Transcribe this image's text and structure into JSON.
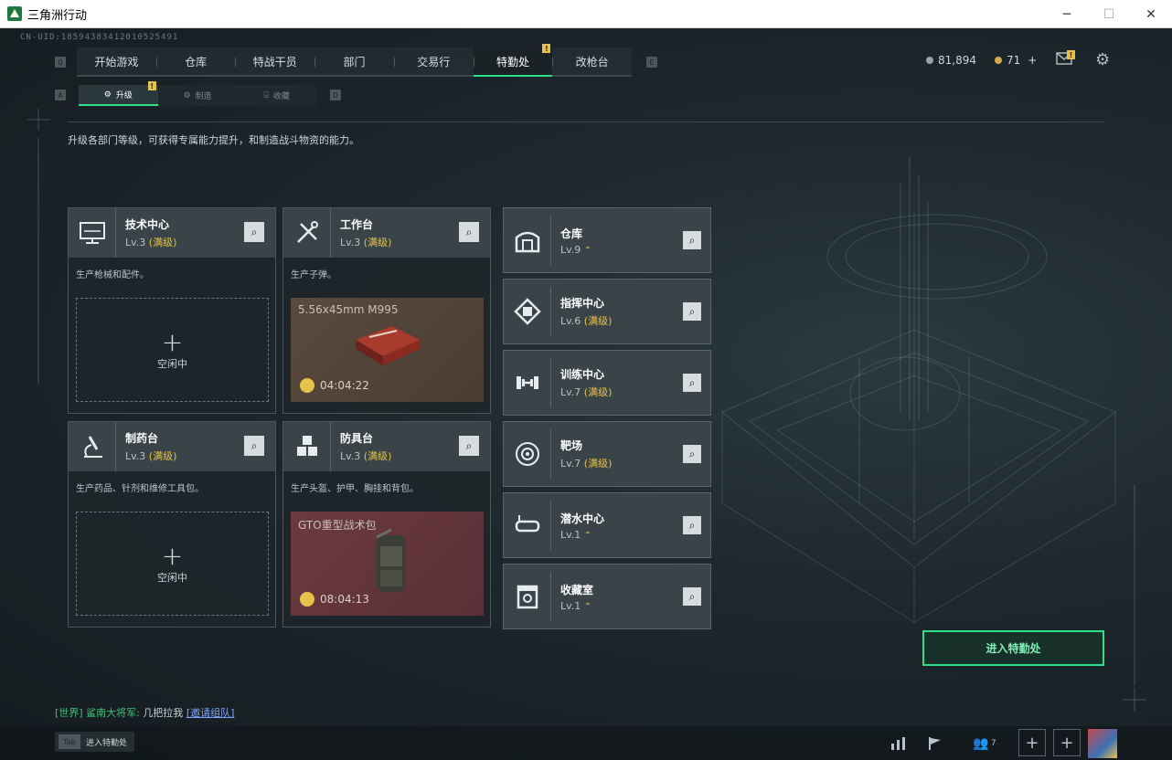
{
  "window": {
    "title": "三角洲行动",
    "controls": [
      "─",
      "☐",
      "✕"
    ]
  },
  "cnuid": "CN-UID:18594383412010525491",
  "nav": {
    "key_left": "Q",
    "key_right": "E",
    "tabs": [
      {
        "label": "开始游戏",
        "active": false
      },
      {
        "label": "仓库",
        "active": false
      },
      {
        "label": "特战干员",
        "active": false
      },
      {
        "label": "部门",
        "active": false
      },
      {
        "label": "交易行",
        "active": false
      },
      {
        "label": "特勤处",
        "active": true,
        "badge": "!"
      },
      {
        "label": "改枪台",
        "active": false
      }
    ]
  },
  "subnav": {
    "key_left": "A",
    "key_right": "D",
    "tabs": [
      {
        "label": "升级",
        "active": true,
        "badge": "!"
      },
      {
        "label": "制造",
        "active": false
      },
      {
        "label": "收藏",
        "active": false
      }
    ]
  },
  "currency": {
    "coins": "81,894",
    "tokens": "71",
    "plus": "+",
    "mail_badge": "!"
  },
  "description": "升级各部门等级，可获得专属能力提升，和制造战斗物资的能力。",
  "stations": [
    {
      "name": "技术中心",
      "level": "Lv.3",
      "max": "(满级)",
      "desc": "生产枪械和配件。",
      "idle_label": "空闲中",
      "plus": "+"
    },
    {
      "name": "工作台",
      "level": "Lv.3",
      "max": "(满级)",
      "desc": "生产子弹。",
      "item": "5.56x45mm M995",
      "timer": "04:04:22"
    },
    {
      "name": "制药台",
      "level": "Lv.3",
      "max": "(满级)",
      "desc": "生产药品、针剂和维修工具包。",
      "idle_label": "空闲中",
      "plus": "+"
    },
    {
      "name": "防具台",
      "level": "Lv.3",
      "max": "(满级)",
      "desc": "生产头盔、护甲、胸挂和背包。",
      "item": "GTO重型战术包",
      "timer": "08:04:13"
    }
  ],
  "facilities": [
    {
      "name": "仓库",
      "level": "Lv.9",
      "max": "",
      "upgradable": true
    },
    {
      "name": "指挥中心",
      "level": "Lv.6",
      "max": "(满级)",
      "upgradable": false
    },
    {
      "name": "训练中心",
      "level": "Lv.7",
      "max": "(满级)",
      "upgradable": false
    },
    {
      "name": "靶场",
      "level": "Lv.7",
      "max": "(满级)",
      "upgradable": false
    },
    {
      "name": "潜水中心",
      "level": "Lv.1",
      "max": "",
      "upgradable": true
    },
    {
      "name": "收藏室",
      "level": "Lv.1",
      "max": "",
      "upgradable": true
    }
  ],
  "enter_button": "进入特勤处",
  "chat": {
    "channel": "[世界]",
    "sender": "鲨南大将军:",
    "message": "几把拉我",
    "invite": "[邀请组队]"
  },
  "bottom": {
    "tab_key": "Tab",
    "tab_label": "进入特勤处",
    "friends_count": "7"
  },
  "colors": {
    "accent": "#2ee08a",
    "max_level": "#e6c24a",
    "badge": "#e6c24a"
  }
}
